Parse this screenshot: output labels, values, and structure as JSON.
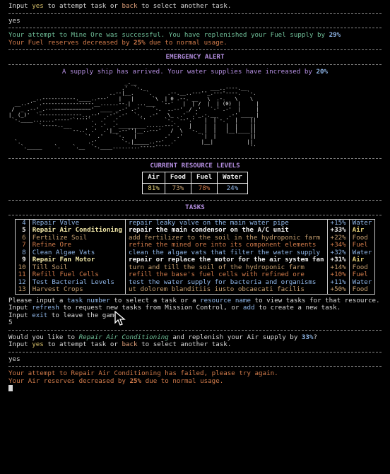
{
  "top_prompt": {
    "pre": "Input ",
    "yes": "yes",
    "mid": " to attempt task or ",
    "back": "back",
    "post": " to select another task."
  },
  "user_input_1": "yes",
  "result_1": {
    "success_pre": "Your attempt to Mine Ore was successful. You have replenished your Fuel supply by ",
    "success_pct": "29%",
    "decrease_pre": "Your Fuel reserves decreased by ",
    "decrease_pct": "25%",
    "decrease_post": " due to normal usage."
  },
  "alert": {
    "heading": "EMERGENCY ALERT",
    "text_pre": "A supply ship has arrived. Your water supplies have increased by ",
    "text_pct": "20%"
  },
  "ascii_ship": [
    "                                      _.__",
    "                                     .'  `-._                     ___..----.__",
    "                                 ..--|__.    `.     .--.__..---''_.---'----.  `-.",
    "        _..-----------.____..---'   |   |      `\\  | 0 .--. __   \\  .-.   \\    \\",
    "  __..-'  .-----------------__......--.|  ...___  `--'   |  | /  |  | (0)  |     |",
    " /  _ .--'_.---~~~~~~~~~~~~'  ____ _.-' .-'    `-.  ..--' _/ .'   `-' .-'  |     |",
    "|  (_)'  `--------------...--'  .-'`.-'  `-.  .-'   \\_  .'  .'_.-.__    .-' ____ |",
    " `-.____.......-----'`''''`.  .'  .'       `'      `-. `--'.'   |  |`-.'  |    ||",
    "          `-----..__       .' .'  .'_________......---`.   |    |  |   |  |    ||",
    "                    `--..' .'  .'|__.--''|__..---'   /  \\  `-._ |  |   |__|____||",
    "                         `'  .'    `-.   |         .'  .'      `|  |           ||",
    "  `.                      .-'        `-.|_____..--'  .'        |__|           ||",
    "    `._____    `.    `.__  `-.____.........-----'''''                          ''"
  ],
  "resources": {
    "heading": "CURRENT RESOURCE LEVELS",
    "headers": [
      "Air",
      "Food",
      "Fuel",
      "Water"
    ],
    "values": [
      "81%",
      "73%",
      "78%",
      "24%"
    ],
    "colors": [
      "#e6d27a",
      "#c8a070",
      "#d07a4a",
      "#8fb6e8"
    ]
  },
  "tasks_heading": "TASKS",
  "tasks": [
    {
      "num": "4",
      "name": "Repair Valve",
      "desc": "repair leaky valve on the main water pipe",
      "pct": "+15%",
      "res": "Water",
      "color": "#8fb6e8",
      "bold": false
    },
    {
      "num": "5",
      "name": "Repair Air Conditioning",
      "desc": "repair the main condensor on the A/C unit",
      "pct": "+33%",
      "res": "Air",
      "color": "#e6d27a",
      "bold": true
    },
    {
      "num": "6",
      "name": "Fertilize Soil",
      "desc": "add fertilizer to the soil in the hydroponic farm",
      "pct": "+22%",
      "res": "Food",
      "color": "#c8a070",
      "bold": false
    },
    {
      "num": "7",
      "name": "Refine Ore",
      "desc": "refine the mined ore into its component elements",
      "pct": "+34%",
      "res": "Fuel",
      "color": "#d07a4a",
      "bold": false
    },
    {
      "num": "8",
      "name": "Clean Algae Vats",
      "desc": "clean the algae vats that filter the water supply",
      "pct": "+32%",
      "res": "Water",
      "color": "#8fb6e8",
      "bold": false
    },
    {
      "num": "9",
      "name": "Repair Fan Motor",
      "desc": "repair or replace the motor for the air system fan",
      "pct": "+31%",
      "res": "Air",
      "color": "#e6d27a",
      "bold": true
    },
    {
      "num": "10",
      "name": "Till Soil",
      "desc": "turn and till the soil of the hydroponic farm",
      "pct": "+14%",
      "res": "Food",
      "color": "#c8a070",
      "bold": false
    },
    {
      "num": "11",
      "name": "Refill Fuel Cells",
      "desc": "refill the base's fuel cells with refined ore",
      "pct": "+10%",
      "res": "Fuel",
      "color": "#d07a4a",
      "bold": false
    },
    {
      "num": "12",
      "name": "Test Bacterial Levels",
      "desc": "test the water supply for bacteria and organisms",
      "pct": "+11%",
      "res": "Water",
      "color": "#8fb6e8",
      "bold": false
    },
    {
      "num": "13",
      "name": "Harvest Crops",
      "desc": "ut dolorem blanditiis iusto obcaecati facilis",
      "pct": "+50%",
      "res": "Food",
      "color": "#c8a070",
      "bold": false
    }
  ],
  "instructions": {
    "l1_pre": "Please input a ",
    "l1_k1": "task number",
    "l1_mid": " to select a task or a ",
    "l1_k2": "resource name",
    "l1_post": " to view tasks for that resource.",
    "l2_pre": "Input ",
    "l2_k1": "refresh",
    "l2_mid": " to request new tasks from Mission Control, or ",
    "l2_k2": "add",
    "l2_post": " to create a new task.",
    "l3_pre": "Input ",
    "l3_k1": "exit",
    "l3_post": " to leave the game."
  },
  "user_input_2": "5",
  "confirm": {
    "pre": "Would you like to ",
    "task": "Repair Air Conditioning",
    "mid": " and replenish your Air supply by ",
    "pct": "33%",
    "post": "?"
  },
  "bottom_prompt": {
    "pre": "Input ",
    "yes": "yes",
    "mid": " to attempt task or ",
    "back": "back",
    "post": " to select another task."
  },
  "user_input_3": "yes",
  "result_2": {
    "fail": "Your attempt to Repair Air Conditioning has failed, please try again.",
    "decrease_pre": "Your Air reserves decreased by ",
    "decrease_pct": "25%",
    "decrease_post": " due to normal usage."
  }
}
